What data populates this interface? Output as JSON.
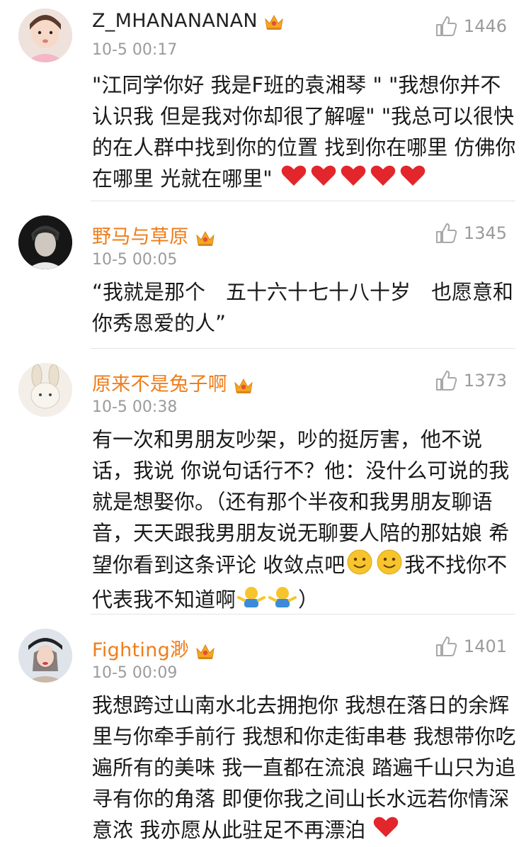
{
  "comments": [
    {
      "username": "Z_MHANANANAN",
      "time": "10-5 00:17",
      "likes": "1446",
      "text": "\"江同学你好 我是F班的袁湘琴 \" \"我想你并不认识我 但是我对你却很了解喔\" \"我总可以很快的在人群中找到你的位置 找到你在哪里 仿佛你在哪里 光就在哪里\"",
      "emoji_trail": [
        "heart-emoji",
        "heart-emoji",
        "heart-emoji",
        "heart-emoji",
        "heart-emoji"
      ]
    },
    {
      "username": "野马与草原",
      "time": "10-5 00:05",
      "likes": "1345",
      "text": "“我就是那个　五十六十七十八十岁　也愿意和你秀恩爱的人”"
    },
    {
      "username": "原来不是兔子啊",
      "time": "10-5 00:38",
      "likes": "1373",
      "text": "有一次和男朋友吵架，吵的挺厉害，他不说话，我说 你说句话行不？他：没什么可说的我就是想娶你。（还有那个半夜和我男朋友聊语音，天天跟我男朋友说无聊要人陪的那姑娘 希望你看到这条评论 收敛点吧",
      "text_after_smiles": "我不找你不代表我不知道啊",
      "text_end": "）"
    },
    {
      "username": "Fighting渺",
      "time": "10-5 00:09",
      "likes": "1401",
      "text": "我想跨过山南水北去拥抱你 我想在落日的余辉里与你牵手前行 我想和你走街串巷 我想带你吃遍所有的美味 我一直都在流浪 踏遍千山只为追寻有你的角落 即便你我之间山长水远若你情深意浓 我亦愿从此驻足不再漂泊"
    }
  ],
  "colors": {
    "vip_name": "#ef7d1a",
    "plain_name": "#222222",
    "meta": "#9b9b9b",
    "divider": "#e3e3e3"
  },
  "icons": {
    "like": "thumbs-up-icon",
    "vip": "crown-icon",
    "heart": "heart-emoji",
    "smile": "smile-emoji",
    "shrug": "shrug-emoji"
  }
}
